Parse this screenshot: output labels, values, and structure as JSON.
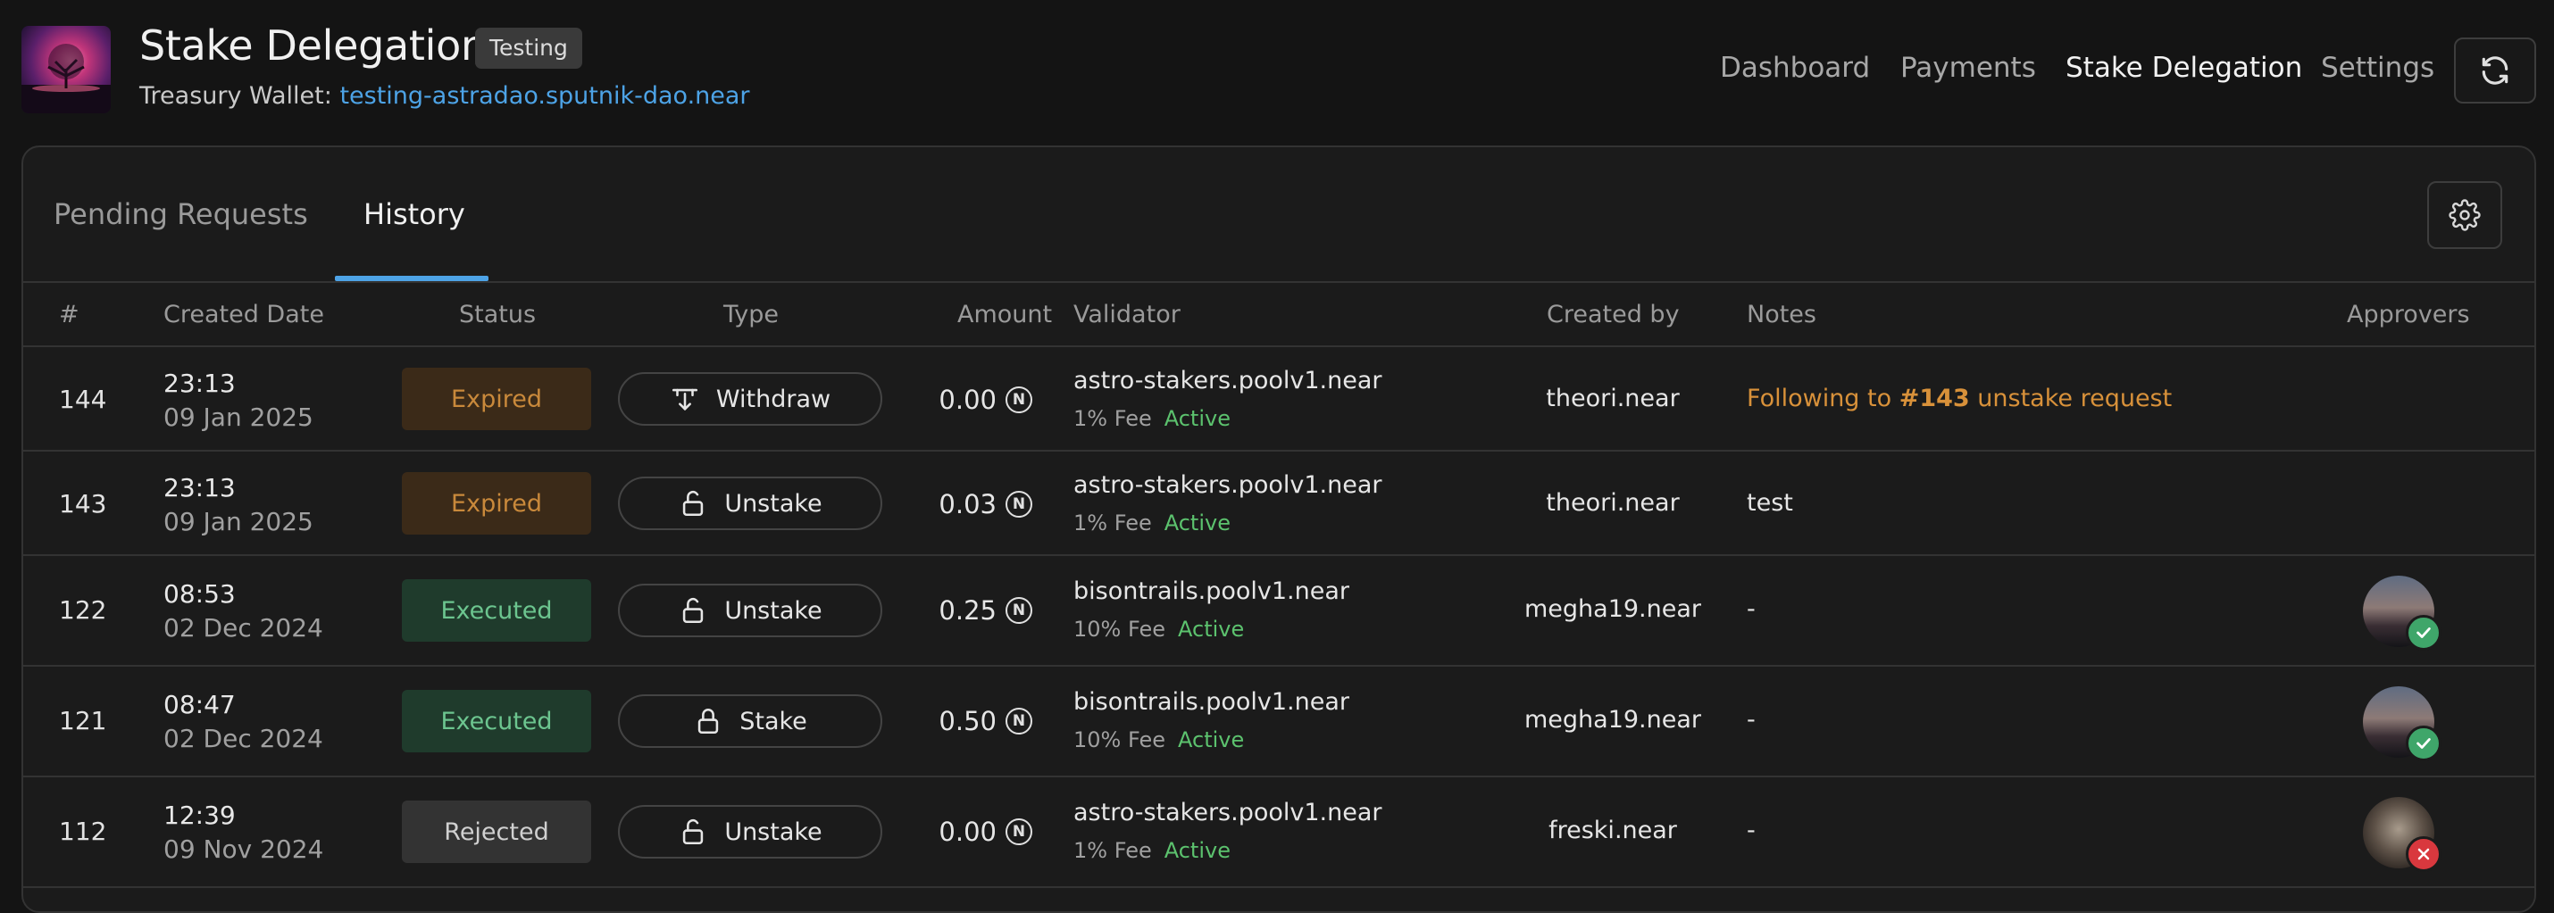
{
  "header": {
    "title": "Stake Delegation",
    "env_badge": "Testing",
    "wallet_label": "Treasury Wallet:",
    "wallet_address": "testing-astradao.sputnik-dao.near",
    "nav": [
      "Dashboard",
      "Payments",
      "Stake Delegation",
      "Settings"
    ],
    "active_nav": "Stake Delegation"
  },
  "tabs": [
    "Pending Requests",
    "History"
  ],
  "active_tab": "History",
  "table": {
    "columns": [
      "#",
      "Created Date",
      "Status",
      "Type",
      "Amount",
      "Validator",
      "Created by",
      "Notes",
      "Approvers"
    ],
    "rows": [
      {
        "id": "144",
        "time": "23:13",
        "date": "09 Jan 2025",
        "status": "Expired",
        "type": "Withdraw",
        "type_icon": "withdraw-icon",
        "amount": "0.00",
        "validator": "astro-stakers.poolv1.near",
        "fee": "1% Fee",
        "validator_status": "Active",
        "created_by": "theori.near",
        "notes_prefix": "Following to ",
        "notes_link": "#143",
        "notes_suffix": " unstake request",
        "approver": ""
      },
      {
        "id": "143",
        "time": "23:13",
        "date": "09 Jan 2025",
        "status": "Expired",
        "type": "Unstake",
        "type_icon": "unlock-icon",
        "amount": "0.03",
        "validator": "astro-stakers.poolv1.near",
        "fee": "1% Fee",
        "validator_status": "Active",
        "created_by": "theori.near",
        "notes": "test",
        "approver": ""
      },
      {
        "id": "122",
        "time": "08:53",
        "date": "02 Dec 2024",
        "status": "Executed",
        "type": "Unstake",
        "type_icon": "unlock-icon",
        "amount": "0.25",
        "validator": "bisontrails.poolv1.near",
        "fee": "10% Fee",
        "validator_status": "Active",
        "created_by": "megha19.near",
        "notes": "-",
        "approver": "approved"
      },
      {
        "id": "121",
        "time": "08:47",
        "date": "02 Dec 2024",
        "status": "Executed",
        "type": "Stake",
        "type_icon": "lock-icon",
        "amount": "0.50",
        "validator": "bisontrails.poolv1.near",
        "fee": "10% Fee",
        "validator_status": "Active",
        "created_by": "megha19.near",
        "notes": "-",
        "approver": "approved"
      },
      {
        "id": "112",
        "time": "12:39",
        "date": "09 Nov 2024",
        "status": "Rejected",
        "type": "Unstake",
        "type_icon": "unlock-icon",
        "amount": "0.00",
        "validator": "astro-stakers.poolv1.near",
        "fee": "1% Fee",
        "validator_status": "Active",
        "created_by": "freski.near",
        "notes": "-",
        "approver": "rejected"
      }
    ]
  },
  "colors": {
    "accent": "#4da3e6",
    "expired": "#c9893b",
    "executed": "#6cc58f",
    "active": "#5cc26e",
    "reject": "#d9383e"
  }
}
